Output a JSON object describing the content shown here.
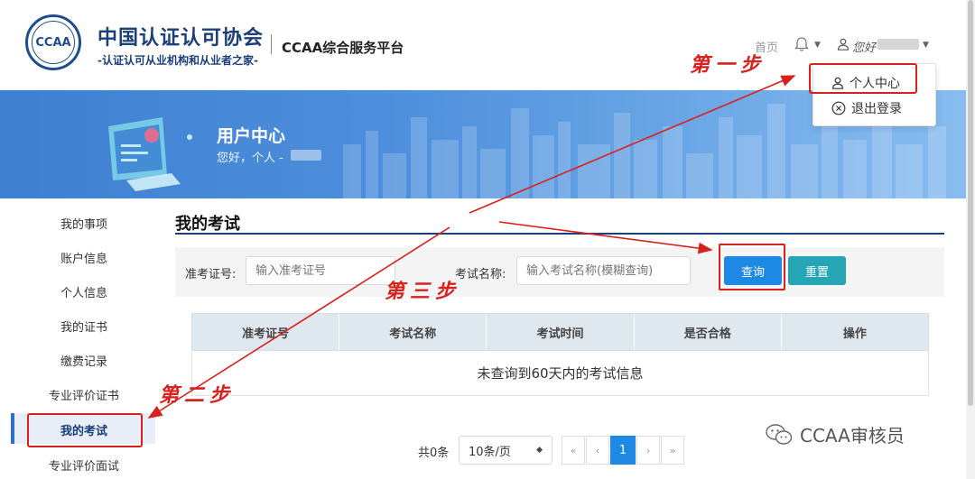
{
  "header": {
    "logo_text": "CCAA",
    "org_name": "中国认证认可协会",
    "org_sub": "-认证认可从业机构和从业者之家-",
    "platform": "CCAA综合服务平台",
    "nav_home": "首页",
    "greeting": "您好"
  },
  "dropdown": {
    "items": [
      {
        "label": "个人中心",
        "icon": "user-icon"
      },
      {
        "label": "退出登录",
        "icon": "close-circle-icon"
      }
    ]
  },
  "banner": {
    "title": "用户中心",
    "subtitle": "您好，个人 -"
  },
  "sidebar": {
    "items": [
      {
        "label": "我的事项"
      },
      {
        "label": "账户信息"
      },
      {
        "label": "个人信息"
      },
      {
        "label": "我的证书"
      },
      {
        "label": "缴费记录"
      },
      {
        "label": "专业评价证书"
      },
      {
        "label": "我的考试",
        "active": true
      },
      {
        "label": "专业评价面试"
      }
    ]
  },
  "main": {
    "title": "我的考试",
    "filters": {
      "ticket_label": "准考证号:",
      "ticket_placeholder": "输入准考证号",
      "exam_label": "考试名称:",
      "exam_placeholder": "输入考试名称(模糊查询)",
      "query_button": "查询",
      "reset_button": "重置"
    },
    "table": {
      "columns": [
        "准考证号",
        "考试名称",
        "考试时间",
        "是否合格",
        "操作"
      ],
      "empty_text": "未查询到60天内的考试信息"
    },
    "pagination": {
      "total": "共0条",
      "page_size": "10条/页",
      "first": "«",
      "prev": "‹",
      "current_page": "1",
      "next": "›",
      "last": "»"
    }
  },
  "annotations": {
    "step1": "第一步",
    "step2": "第二步",
    "step3": "第三步"
  },
  "watermark": "CCAA审核员",
  "colors": {
    "brand_navy": "#1a3f7a",
    "query_blue": "#1e88e5",
    "reset_teal": "#26a5b5",
    "annotation_red": "#d9201c"
  }
}
